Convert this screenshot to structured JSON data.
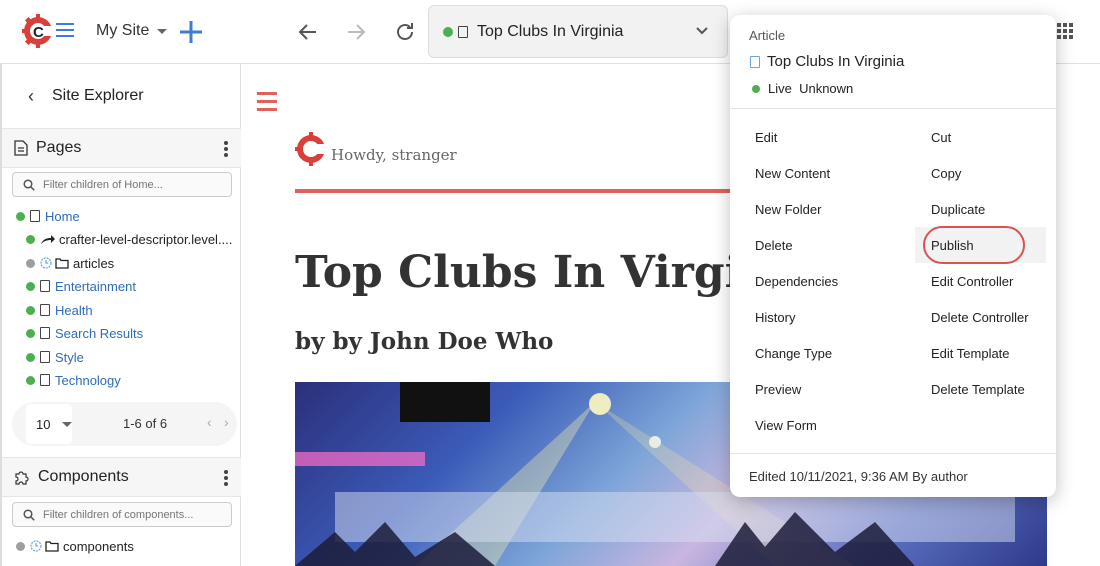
{
  "topbar": {
    "site_name": "My Site",
    "url_title": "Top Clubs In Virginia",
    "brand_red": "#d9403a",
    "accent_blue": "#3f7bd6"
  },
  "sidebar": {
    "header": "Site Explorer",
    "pages": {
      "title": "Pages",
      "filter_placeholder": "Filter children of Home...",
      "items": [
        {
          "label": "Home",
          "link": true,
          "status": "green",
          "icon": "file-icon"
        },
        {
          "label": "crafter-level-descriptor.level....",
          "link": false,
          "status": "green",
          "icon": "share-icon"
        },
        {
          "label": "articles",
          "link": false,
          "status": "gray",
          "icon": "folder-icon"
        },
        {
          "label": "Entertainment",
          "link": true,
          "status": "green",
          "icon": "file-icon"
        },
        {
          "label": "Health",
          "link": true,
          "status": "green",
          "icon": "file-icon"
        },
        {
          "label": "Search Results",
          "link": true,
          "status": "green",
          "icon": "file-icon"
        },
        {
          "label": "Style",
          "link": true,
          "status": "green",
          "icon": "file-icon"
        },
        {
          "label": "Technology",
          "link": true,
          "status": "green",
          "icon": "file-icon"
        }
      ],
      "rows_per_page": "10",
      "range": "1-6 of 6"
    },
    "components": {
      "title": "Components",
      "filter_placeholder": "Filter children of components...",
      "items": [
        {
          "label": "components",
          "status": "gray",
          "icon": "folder-icon"
        }
      ]
    }
  },
  "preview": {
    "greeting": "Howdy, stranger",
    "title": "Top Clubs In Virginia",
    "byline": "by by John Doe Who"
  },
  "popover": {
    "type": "Article",
    "name": "Top Clubs In Virginia",
    "status": "Live  Unknown",
    "left_actions": [
      "Edit",
      "New Content",
      "New Folder",
      "Delete",
      "Dependencies",
      "History",
      "Change Type",
      "Preview",
      "View Form"
    ],
    "right_actions": [
      "Cut",
      "Copy",
      "Duplicate",
      "Publish",
      "Edit Controller",
      "Delete Controller",
      "Edit Template",
      "Delete Template"
    ],
    "footer": "Edited 10/11/2021, 9:36 AM By author"
  }
}
